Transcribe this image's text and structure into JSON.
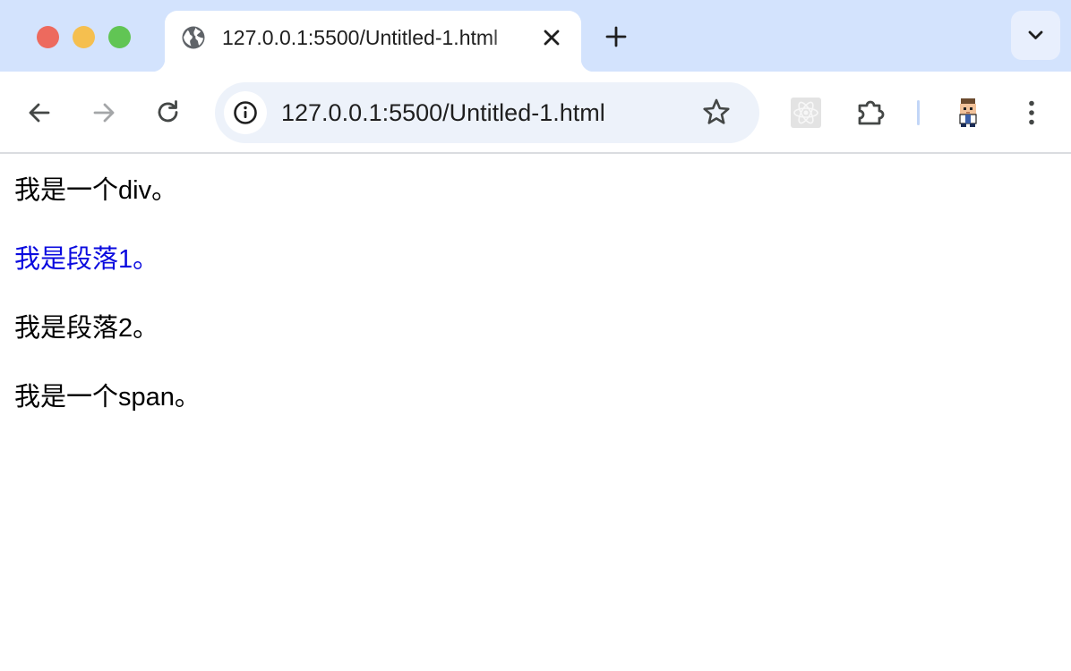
{
  "browser": {
    "tab": {
      "title": "127.0.0.1:5500/Untitled-1.html",
      "favicon": "globe-icon"
    },
    "address_bar": {
      "url": "127.0.0.1:5500/Untitled-1.html"
    },
    "icons": {
      "back": "arrow-left-icon",
      "forward": "arrow-right-icon",
      "reload": "reload-icon",
      "site_info": "info-icon",
      "bookmark": "star-icon",
      "react_devtools": "react-icon",
      "extensions": "puzzle-icon",
      "profile": "avatar-icon",
      "menu": "kebab-menu-icon",
      "new_tab": "plus-icon",
      "tab_search": "chevron-down-icon",
      "close_tab": "close-icon"
    }
  },
  "page": {
    "lines": [
      {
        "text": "我是一个div。",
        "color": "#000000"
      },
      {
        "text": "我是段落1。",
        "color": "#0a0adf"
      },
      {
        "text": "我是段落2。",
        "color": "#000000"
      },
      {
        "text": "我是一个span。",
        "color": "#000000"
      }
    ]
  },
  "colors": {
    "tabstrip": "#d3e3fd",
    "omnibox": "#edf2fa",
    "close_button": "#ed6a5e",
    "minimize_button": "#f5bf4f",
    "maximize_button": "#61c554"
  }
}
